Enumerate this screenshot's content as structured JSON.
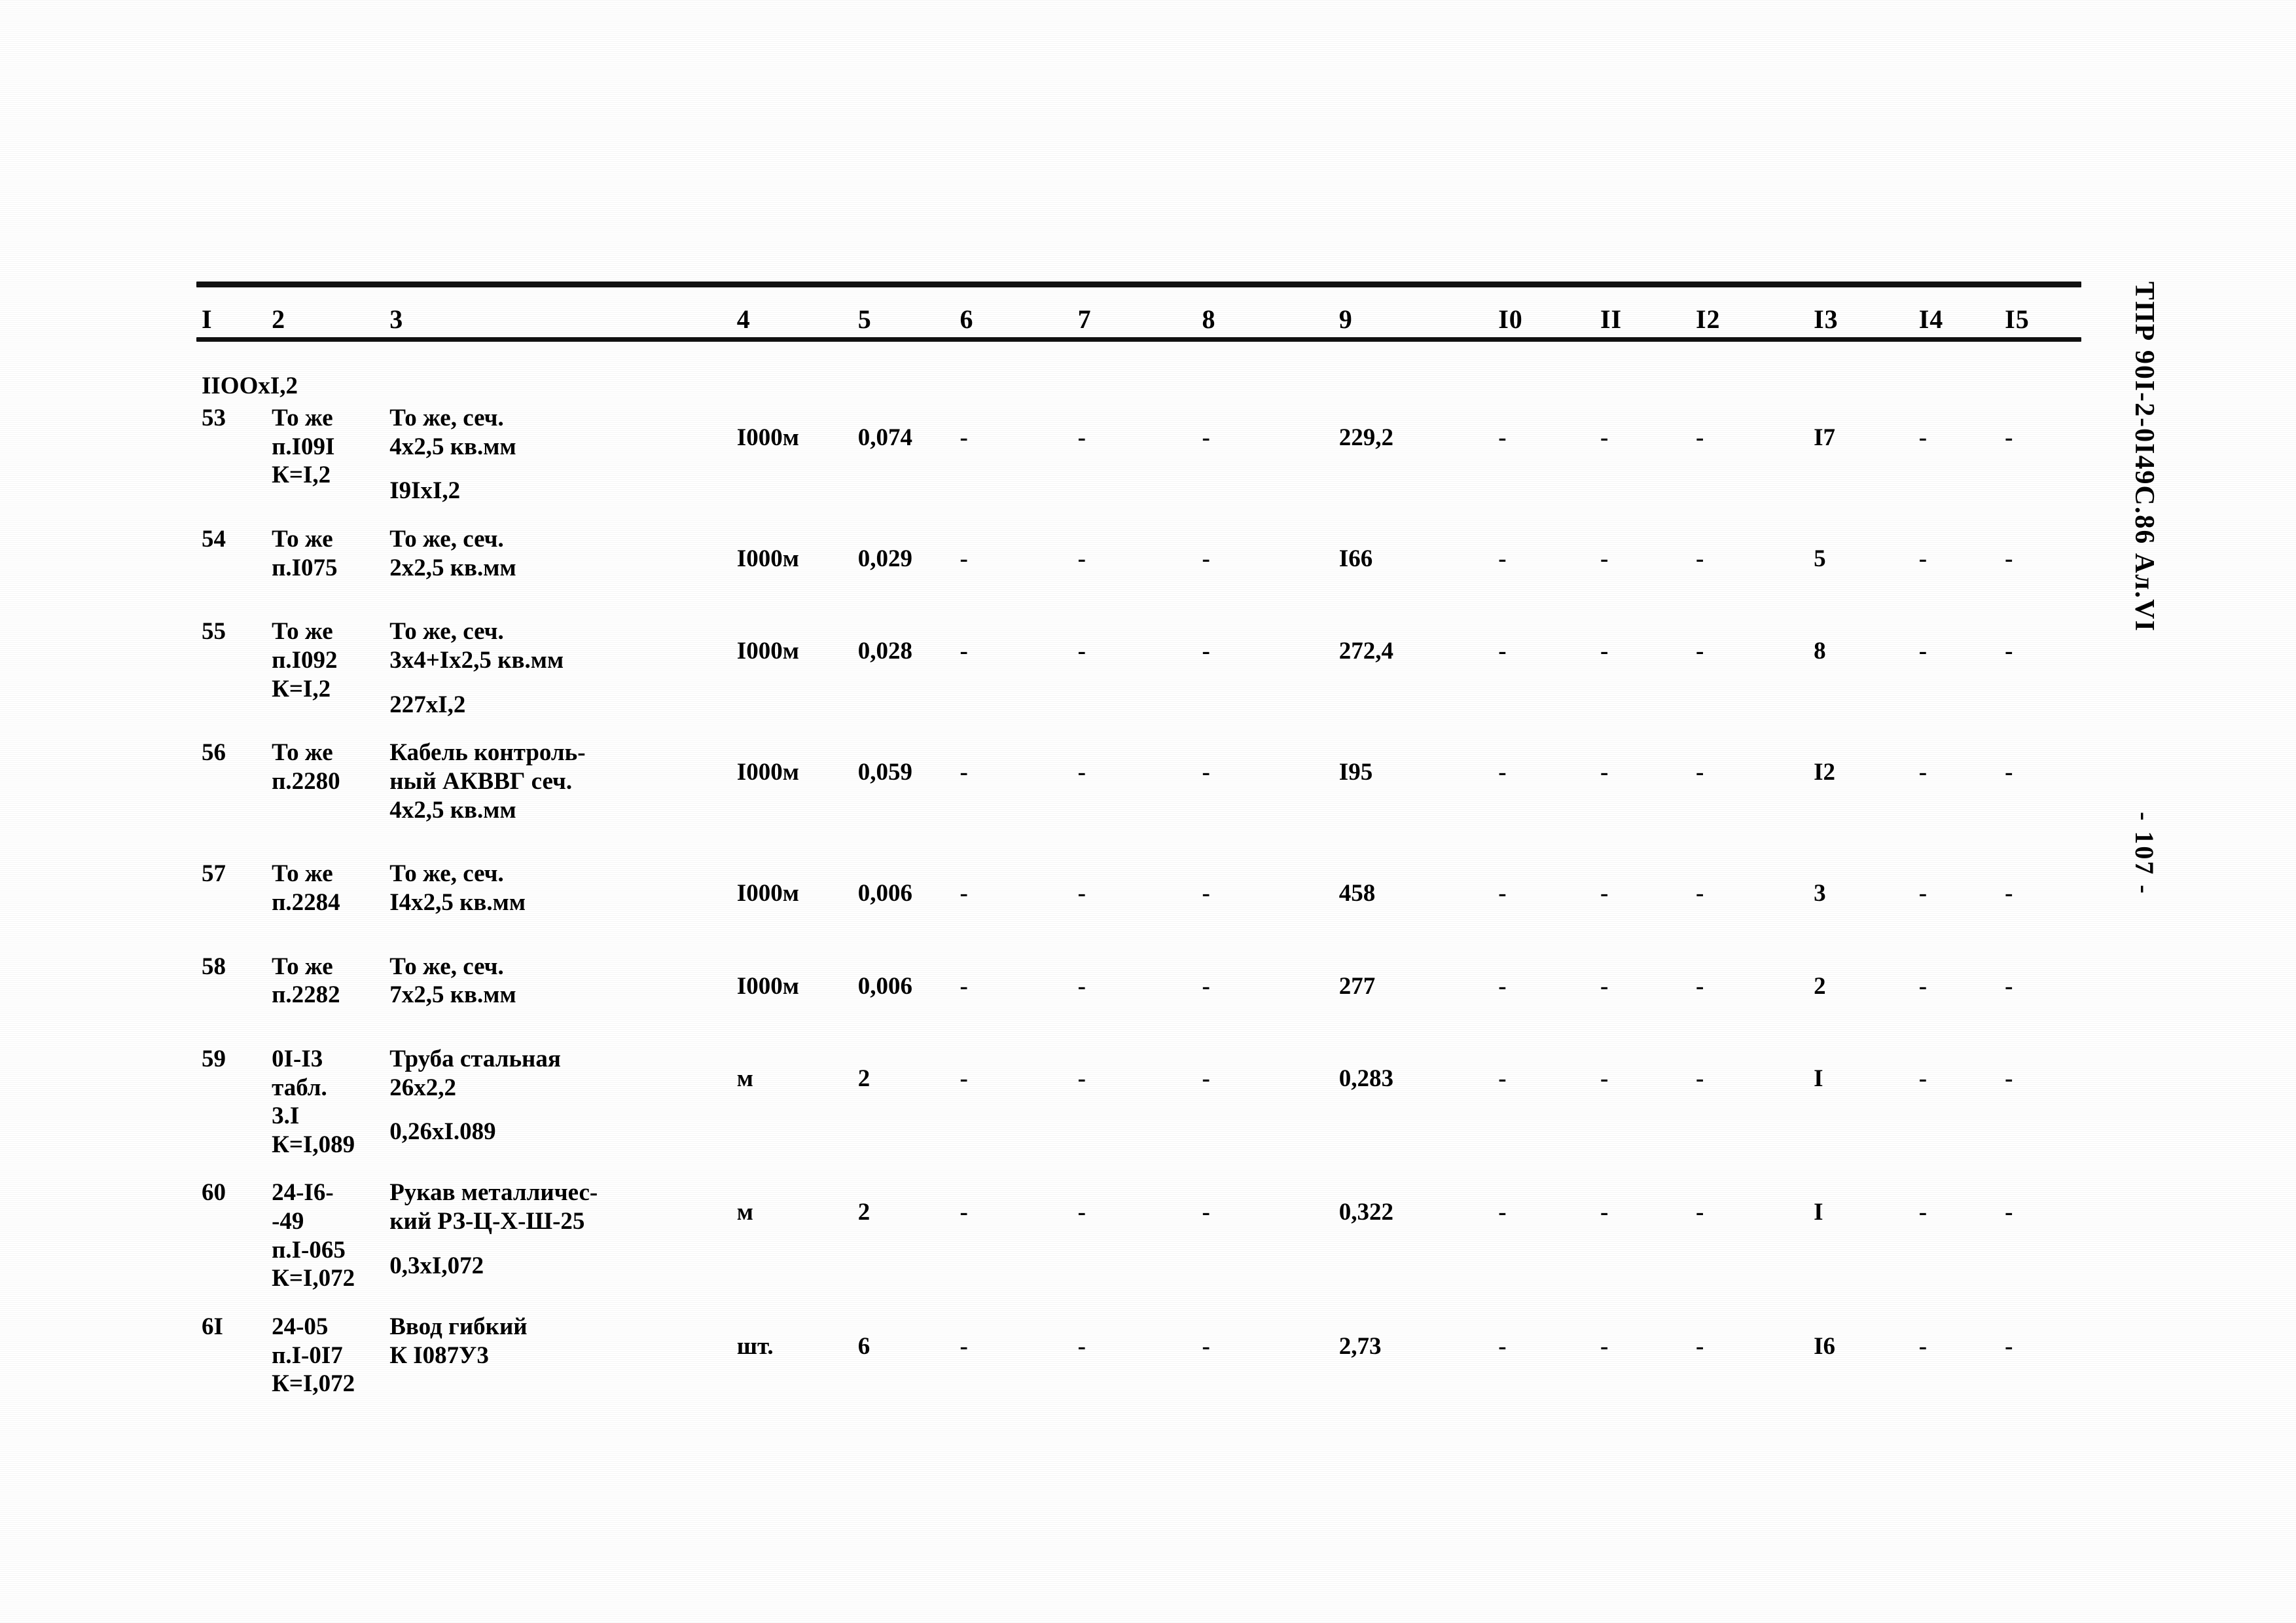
{
  "document": {
    "code": "ТПР 90I-2-0I49С.86  Ал.VI",
    "page_number": "- 107 -"
  },
  "table": {
    "column_headers": [
      "I",
      "2",
      "3",
      "4",
      "5",
      "6",
      "7",
      "8",
      "9",
      "I0",
      "II",
      "I2",
      "I3",
      "I4",
      "I5"
    ],
    "continued_row_fragment": "IIООхI,2",
    "rows": [
      {
        "c1": "53",
        "c2": "То же\nп.I09I\nК=I,2",
        "c3": "То же, сеч.\n4х2,5 кв.мм",
        "c3_sub": "I9IхI,2",
        "c4": "I000м",
        "c5": "0,074",
        "c6": "-",
        "c7": "-",
        "c8": "-",
        "c9": "229,2",
        "c10": "-",
        "c11": "-",
        "c12": "-",
        "c13": "I7",
        "c14": "-",
        "c15": "-"
      },
      {
        "c1": "54",
        "c2": "То же\nп.I075",
        "c3": "То же, сеч.\n2х2,5 кв.мм",
        "c3_sub": "",
        "c4": "I000м",
        "c5": "0,029",
        "c6": "-",
        "c7": "-",
        "c8": "-",
        "c9": "I66",
        "c10": "-",
        "c11": "-",
        "c12": "-",
        "c13": "5",
        "c14": "-",
        "c15": "-"
      },
      {
        "c1": "55",
        "c2": "То же\nп.I092\nК=I,2",
        "c3": "То же, сеч.\n3х4+Iх2,5 кв.мм",
        "c3_sub": "227хI,2",
        "c4": "I000м",
        "c5": "0,028",
        "c6": "-",
        "c7": "-",
        "c8": "-",
        "c9": "272,4",
        "c10": "-",
        "c11": "-",
        "c12": "-",
        "c13": "8",
        "c14": "-",
        "c15": "-"
      },
      {
        "c1": "56",
        "c2": "То же\nп.2280",
        "c3": "Кабель контроль-\nный АКВВГ сеч.\n4х2,5 кв.мм",
        "c3_sub": "",
        "c4": "I000м",
        "c5": "0,059",
        "c6": "-",
        "c7": "-",
        "c8": "-",
        "c9": "I95",
        "c10": "-",
        "c11": "-",
        "c12": "-",
        "c13": "I2",
        "c14": "-",
        "c15": "-"
      },
      {
        "c1": "57",
        "c2": "То же\nп.2284",
        "c3": "То же, сеч.\nI4х2,5 кв.мм",
        "c3_sub": "",
        "c4": "I000м",
        "c5": "0,006",
        "c6": "-",
        "c7": "-",
        "c8": "-",
        "c9": "458",
        "c10": "-",
        "c11": "-",
        "c12": "-",
        "c13": "3",
        "c14": "-",
        "c15": "-"
      },
      {
        "c1": "58",
        "c2": "То же\nп.2282",
        "c3": "То же, сеч.\n7х2,5 кв.мм",
        "c3_sub": "",
        "c4": "I000м",
        "c5": "0,006",
        "c6": "-",
        "c7": "-",
        "c8": "-",
        "c9": "277",
        "c10": "-",
        "c11": "-",
        "c12": "-",
        "c13": "2",
        "c14": "-",
        "c15": "-"
      },
      {
        "c1": "59",
        "c2": "0I-I3\nтабл.\n3.I\nК=I,089",
        "c3": "Труба стальная\n26х2,2",
        "c3_sub": "0,26хI.089",
        "c4": "м",
        "c5": "2",
        "c6": "-",
        "c7": "-",
        "c8": "-",
        "c9": "0,283",
        "c10": "-",
        "c11": "-",
        "c12": "-",
        "c13": "I",
        "c14": "-",
        "c15": "-"
      },
      {
        "c1": "60",
        "c2": "24-I6-\n-49\nп.I-065\nК=I,072",
        "c3": "Рукав металличес-\nкий РЗ-Ц-Х-Ш-25",
        "c3_sub": "0,3хI,072",
        "c4": "м",
        "c5": "2",
        "c6": "-",
        "c7": "-",
        "c8": "-",
        "c9": "0,322",
        "c10": "-",
        "c11": "-",
        "c12": "-",
        "c13": "I",
        "c14": "-",
        "c15": "-"
      },
      {
        "c1": "6I",
        "c2": "24-05\nп.I-0I7\nК=I,072",
        "c3": "Ввод гибкий\nК I087У3",
        "c3_sub": "",
        "c4": "шт.",
        "c5": "6",
        "c6": "-",
        "c7": "-",
        "c8": "-",
        "c9": "2,73",
        "c10": "-",
        "c11": "-",
        "c12": "-",
        "c13": "I6",
        "c14": "-",
        "c15": "-"
      }
    ]
  }
}
